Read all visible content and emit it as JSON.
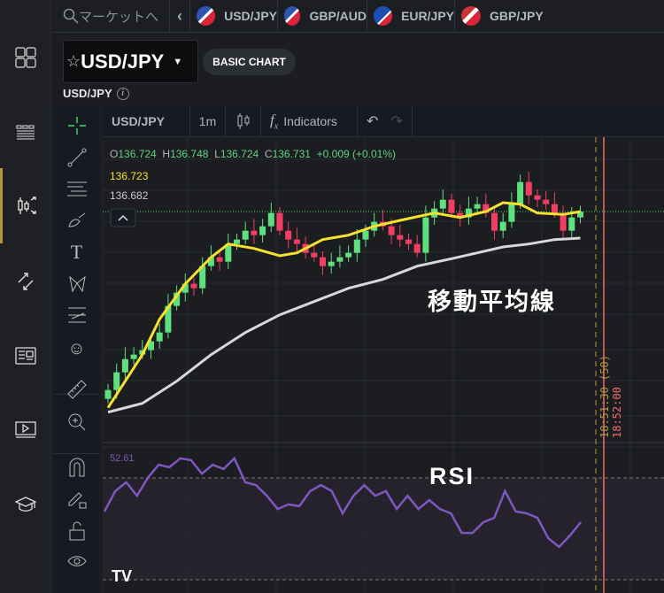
{
  "nav": {
    "items": [
      {
        "icon": "dashboard-icon"
      },
      {
        "icon": "markets-list-icon"
      },
      {
        "icon": "chart-trade-icon",
        "active": true
      },
      {
        "icon": "exchange-icon"
      },
      {
        "icon": "news-icon"
      },
      {
        "icon": "video-icon"
      },
      {
        "icon": "education-icon"
      }
    ],
    "accent": "#b8973a"
  },
  "topbar": {
    "search_placeholder": "マーケットへ",
    "tabs": [
      {
        "label": "USD/JPY"
      },
      {
        "label": "GBP/AUD"
      },
      {
        "label": "EUR/JPY"
      },
      {
        "label": "GBP/JPY"
      }
    ]
  },
  "header": {
    "symbol": "USD/JPY",
    "basic_chart": "BASIC CHART",
    "subtitle": "USD/JPY"
  },
  "chart_toolbar": {
    "symbol": "USD/JPY",
    "interval": "1m",
    "indicators": "Indicators"
  },
  "legend": {
    "o_label": "O",
    "o": "136.724",
    "h_label": "H",
    "h": "136.748",
    "l_label": "L",
    "l": "136.724",
    "c_label": "C",
    "c": "136.731",
    "change": "+0.009 (+0.01%)",
    "ma_fast": "136.723",
    "ma_slow": "136.682"
  },
  "annotations": {
    "ma": "移動平均線",
    "rsi": "RSI"
  },
  "time_labels": {
    "cursor": "18:51:30 (50)",
    "current": "18:52:00"
  },
  "colors": {
    "up": "#5fe07f",
    "down": "#f23e62",
    "ma_fast": "#f5e130",
    "ma_slow": "#d8d8dc",
    "rsi": "#7e57c2",
    "cursor_line": "#f26d6d"
  },
  "chart_data": {
    "type": "candlestick",
    "last_price": 136.731,
    "closes": [
      136.61,
      136.622,
      136.631,
      136.634,
      136.637,
      136.643,
      136.649,
      136.667,
      136.676,
      136.682,
      136.679,
      136.694,
      136.7,
      136.697,
      136.709,
      136.712,
      136.718,
      136.715,
      136.721,
      136.73,
      136.718,
      136.712,
      136.709,
      136.703,
      136.7,
      136.694,
      136.697,
      136.7,
      136.703,
      136.712,
      136.718,
      136.724,
      136.721,
      136.715,
      136.712,
      136.709,
      136.703,
      136.727,
      136.733,
      136.739,
      136.73,
      136.727,
      136.733,
      136.736,
      136.73,
      136.718,
      136.724,
      136.736,
      136.751,
      136.742,
      136.739,
      136.736,
      136.73,
      136.718,
      136.727,
      136.731
    ],
    "ma_fast": [
      [
        0,
        136.598
      ],
      [
        2,
        136.616
      ],
      [
        4,
        136.634
      ],
      [
        6,
        136.658
      ],
      [
        9,
        136.682
      ],
      [
        12,
        136.7
      ],
      [
        14,
        136.709
      ],
      [
        17,
        136.706
      ],
      [
        20,
        136.701
      ],
      [
        22,
        136.703
      ],
      [
        25,
        136.712
      ],
      [
        28,
        136.715
      ],
      [
        31,
        136.721
      ],
      [
        34,
        136.725
      ],
      [
        38,
        136.73
      ],
      [
        41,
        136.727
      ],
      [
        44,
        136.731
      ],
      [
        46,
        136.737
      ],
      [
        48,
        136.736
      ],
      [
        50,
        136.73
      ],
      [
        53,
        136.729
      ],
      [
        55,
        136.731
      ]
    ],
    "ma_slow": [
      [
        0,
        136.595
      ],
      [
        4,
        136.601
      ],
      [
        8,
        136.616
      ],
      [
        12,
        136.634
      ],
      [
        16,
        136.649
      ],
      [
        20,
        136.661
      ],
      [
        24,
        136.67
      ],
      [
        28,
        136.679
      ],
      [
        32,
        136.685
      ],
      [
        36,
        136.694
      ],
      [
        40,
        136.699
      ],
      [
        43,
        136.703
      ],
      [
        46,
        136.707
      ],
      [
        49,
        136.709
      ],
      [
        52,
        136.712
      ],
      [
        55,
        136.713
      ]
    ],
    "rsi": {
      "current": "52.61",
      "levels": [
        70,
        30
      ],
      "values": [
        56.8,
        64.8,
        68.3,
        63.0,
        70,
        75.2,
        74.2,
        77.7,
        77.0,
        71.7,
        75.2,
        73.5,
        77.7,
        68.3,
        67.2,
        63.0,
        57.8,
        59.6,
        58.9,
        64.8,
        67.2,
        64.8,
        56.1,
        63.0,
        67.2,
        63.0,
        64.8,
        57.8,
        63.0,
        57.8,
        61.3,
        57.8,
        56.1,
        48.4,
        48.4,
        52.6,
        54.3,
        64.8,
        56.8,
        56.1,
        54.3,
        46.3,
        42.9,
        47.4,
        52.6
      ]
    }
  }
}
